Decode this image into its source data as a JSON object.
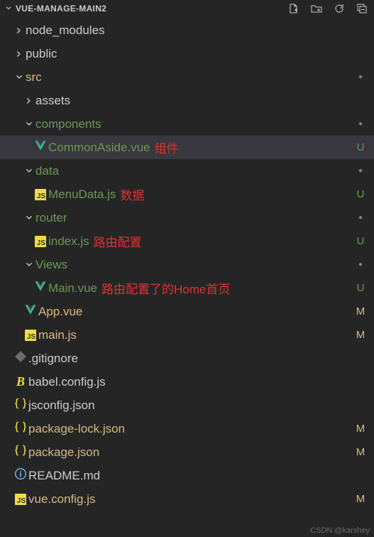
{
  "header": {
    "title": "VUE-MANAGE-MAIN2",
    "actions": [
      "new-file",
      "new-folder",
      "refresh",
      "collapse-all"
    ]
  },
  "annotations": {
    "component": "组件",
    "data": "数据",
    "router": "路由配置",
    "home": "路由配置了的Home首页"
  },
  "status_labels": {
    "U": "U",
    "M": "M"
  },
  "tree": [
    {
      "depth": 0,
      "kind": "folder",
      "name": "node_modules",
      "expanded": false
    },
    {
      "depth": 0,
      "kind": "folder",
      "name": "public",
      "expanded": false
    },
    {
      "depth": 0,
      "kind": "folder",
      "name": "src",
      "expanded": true,
      "nameClass": "yelw",
      "dot": true
    },
    {
      "depth": 1,
      "kind": "folder",
      "name": "assets",
      "expanded": false
    },
    {
      "depth": 1,
      "kind": "folder",
      "name": "components",
      "expanded": true,
      "nameClass": "u",
      "dot": true
    },
    {
      "depth": 2,
      "kind": "file",
      "icon": "vue",
      "name": "CommonAside.vue",
      "status": "U",
      "selected": true,
      "annoKey": "component"
    },
    {
      "depth": 1,
      "kind": "folder",
      "name": "data",
      "expanded": true,
      "nameClass": "u",
      "dot": true
    },
    {
      "depth": 2,
      "kind": "file",
      "icon": "js",
      "name": "MenuData.js",
      "status": "U",
      "annoKey": "data"
    },
    {
      "depth": 1,
      "kind": "folder",
      "name": "router",
      "expanded": true,
      "nameClass": "u",
      "dot": true
    },
    {
      "depth": 2,
      "kind": "file",
      "icon": "js",
      "name": "index.js",
      "status": "U",
      "annoKey": "router"
    },
    {
      "depth": 1,
      "kind": "folder",
      "name": "Views",
      "expanded": true,
      "nameClass": "u",
      "dot": true
    },
    {
      "depth": 2,
      "kind": "file",
      "icon": "vue",
      "name": "Main.vue",
      "status": "U",
      "annoKey": "home"
    },
    {
      "depth": 1,
      "kind": "file",
      "icon": "vue",
      "name": "App.vue",
      "status": "M",
      "nameClass": "yelw"
    },
    {
      "depth": 1,
      "kind": "file",
      "icon": "js",
      "name": "main.js",
      "status": "M",
      "nameClass": "yelw"
    },
    {
      "depth": 0,
      "kind": "file",
      "icon": "git",
      "name": ".gitignore"
    },
    {
      "depth": 0,
      "kind": "file",
      "icon": "babel",
      "name": "babel.config.js"
    },
    {
      "depth": 0,
      "kind": "file",
      "icon": "json",
      "name": "jsconfig.json"
    },
    {
      "depth": 0,
      "kind": "file",
      "icon": "json",
      "name": "package-lock.json",
      "status": "M",
      "nameClass": "yelw"
    },
    {
      "depth": 0,
      "kind": "file",
      "icon": "json",
      "name": "package.json",
      "status": "M",
      "nameClass": "yelw"
    },
    {
      "depth": 0,
      "kind": "file",
      "icon": "info",
      "name": "README.md"
    },
    {
      "depth": 0,
      "kind": "file",
      "icon": "js",
      "name": "vue.config.js",
      "status": "M",
      "nameClass": "yelw"
    }
  ],
  "watermark": "CSDN @karshey"
}
